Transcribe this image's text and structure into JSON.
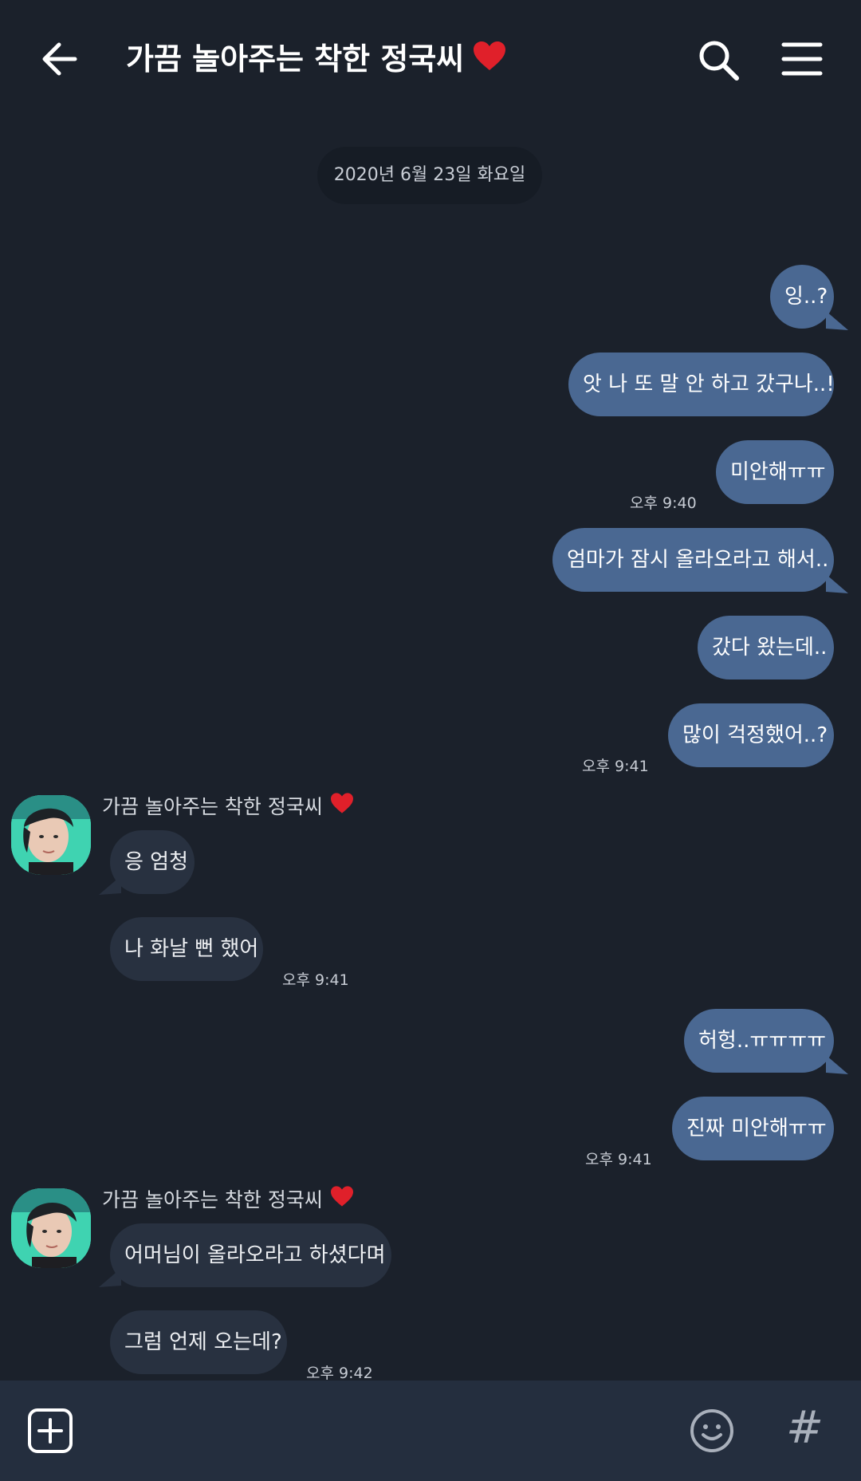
{
  "header": {
    "title": "가끔 놀아주는 착한 정국씨",
    "back_icon": "arrow-left-icon",
    "search_icon": "search-icon",
    "menu_icon": "hamburger-menu-icon"
  },
  "date_divider": "2020년 6월 23일 화요일",
  "messages": [
    {
      "from": "me",
      "text": "잉..?"
    },
    {
      "from": "me",
      "text": "앗 나 또 말 안 하고 갔구나..!"
    },
    {
      "from": "me",
      "text": "미안해ㅠㅠ",
      "time": "오후 9:40"
    },
    {
      "from": "me",
      "text": "엄마가 잠시 올라오라고 해서.."
    },
    {
      "from": "me",
      "text": "갔다 왔는데.."
    },
    {
      "from": "me",
      "text": "많이 걱정했어..?",
      "time": "오후 9:41"
    },
    {
      "from": "them",
      "sender": "가끔 놀아주는 착한 정국씨",
      "text": "응 엄청"
    },
    {
      "from": "them",
      "text": "나 화날 뻔 했어",
      "time": "오후 9:41"
    },
    {
      "from": "me",
      "text": "허헝..ㅠㅠㅠㅠ"
    },
    {
      "from": "me",
      "text": "진짜 미안해ㅠㅠ",
      "time": "오후 9:41"
    },
    {
      "from": "them",
      "sender": "가끔 놀아주는 착한 정국씨",
      "text": "어머님이 올라오라고 하셨다며"
    },
    {
      "from": "them",
      "text": "그럼 언제 오는데?",
      "time": "오후 9:42"
    }
  ],
  "bottom_bar": {
    "plus_icon": "plus-square-icon",
    "emoji_icon": "smiley-icon",
    "hash_label": "#"
  },
  "colors": {
    "background": "#1b212b",
    "my_bubble": "#4a6892",
    "their_bubble": "#283140",
    "bottom_bar": "#242e3e",
    "heart": "#e0202a"
  }
}
